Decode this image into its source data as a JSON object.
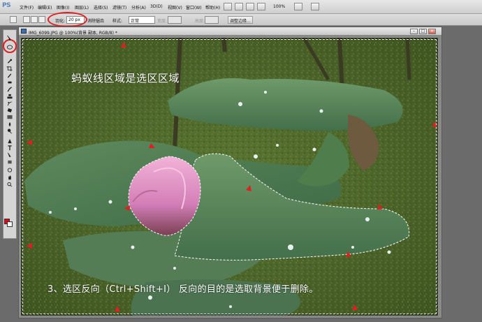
{
  "app": {
    "logo": "PS"
  },
  "menubar": {
    "items": [
      "文件(F)",
      "编辑(E)",
      "图像(I)",
      "图层(L)",
      "选择(S)",
      "滤镜(T)",
      "分析(A)",
      "3D(D)",
      "视图(V)",
      "窗口(W)",
      "帮助(H)"
    ],
    "zoom": "100%"
  },
  "options": {
    "feather_label": "羽化:",
    "feather_value": "20 px",
    "antialias_label": "消除锯齿",
    "style_label": "样式:",
    "style_value": "正常",
    "width_label": "宽度:",
    "height_label": "高度:",
    "refine_edge_label": "调整边缘..."
  },
  "document": {
    "title": "IMG_6099.JPG @ 100%(背景 副本, RGB/8) *",
    "minimize": "–",
    "restore": "□",
    "close": "×"
  },
  "captions": {
    "top": "蚂蚁线区域是选区区域",
    "bottom": "3、选区反向（Ctrl+Shift+I）  反向的目的是选取背景便于删除。"
  },
  "colors": {
    "annotation_red": "#e02020",
    "foreground": "#e60012",
    "background": "#ffffff",
    "photo_green": "#4f6a2c",
    "lotus_pink": "#e79ac8"
  },
  "icons": [
    "move-tool-icon",
    "lasso-tool-icon",
    "quick-select-icon",
    "crop-icon",
    "eyedropper-icon",
    "healing-brush-icon",
    "brush-icon",
    "clone-stamp-icon",
    "history-brush-icon",
    "eraser-icon",
    "gradient-icon",
    "blur-icon",
    "dodge-icon",
    "pen-icon",
    "type-icon",
    "path-select-icon",
    "shape-icon",
    "3d-rotate-icon",
    "hand-icon",
    "zoom-icon"
  ]
}
